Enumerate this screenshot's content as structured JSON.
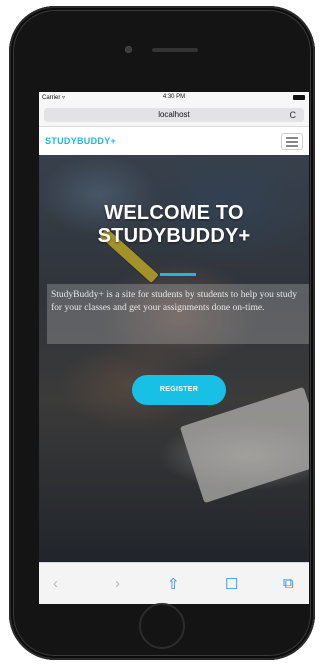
{
  "status_bar": {
    "carrier": "Carrier ▿",
    "time": "4:30 PM"
  },
  "browser": {
    "url": "localhost",
    "reload_glyph": "C"
  },
  "site": {
    "brand": "STUDYBUDDY+",
    "hero_title_line1": "WELCOME TO",
    "hero_title_line2": "STUDYBUDDY+",
    "description": "StudyBuddy+ is a site for students by students to help you study for your classes and get your assignments done on-time.",
    "register_label": "REGISTER",
    "accent_color": "#22b6dd"
  },
  "toolbar": {
    "back": "‹",
    "forward": "›",
    "share": "⇧",
    "bookmarks": "☐",
    "tabs": "⧉"
  },
  "icons": [
    "back-icon",
    "forward-icon",
    "share-icon",
    "bookmarks-icon",
    "tabs-icon",
    "menu-icon",
    "reload-icon",
    "battery-icon"
  ]
}
